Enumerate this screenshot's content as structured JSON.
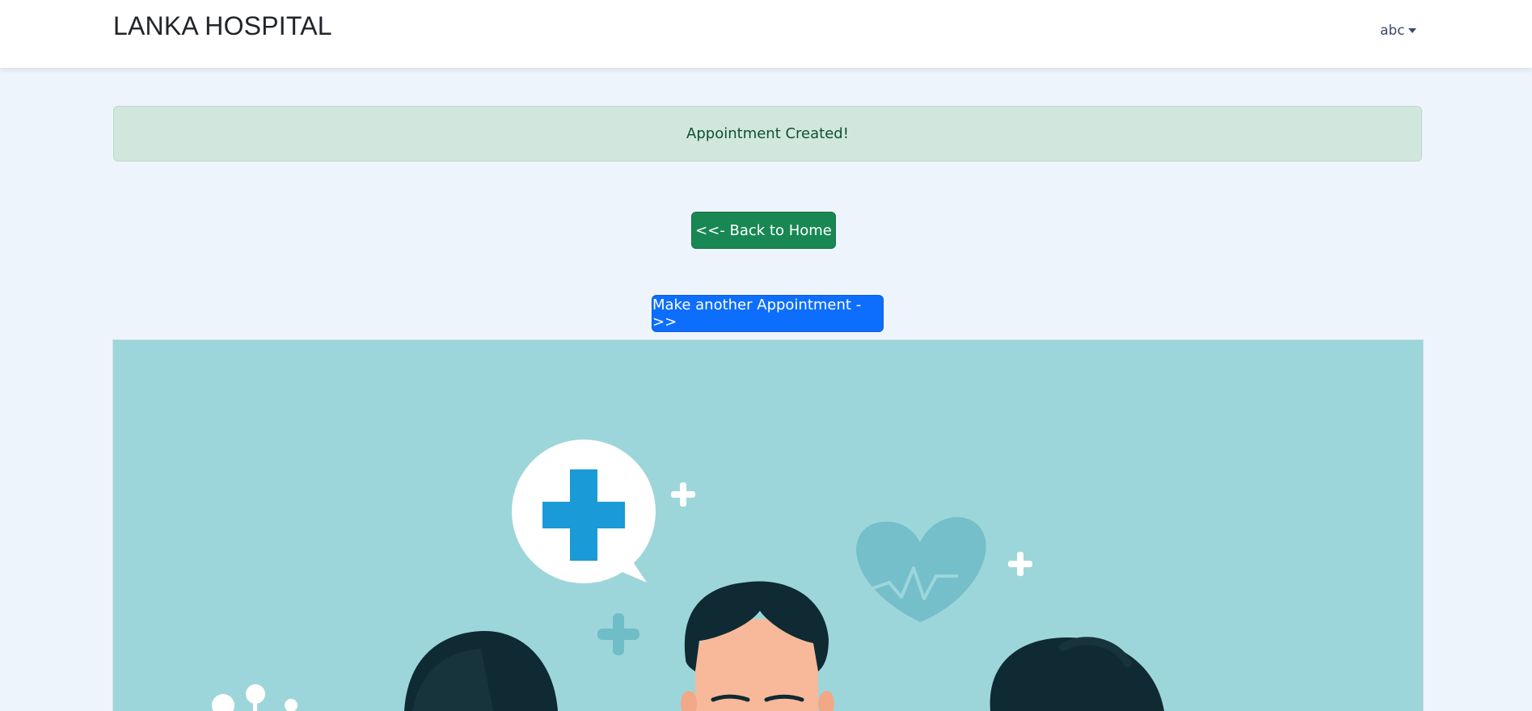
{
  "navbar": {
    "brand": "LANKA HOSPITAL",
    "user_menu_label": "abc"
  },
  "alert": {
    "message": "Appointment Created!"
  },
  "actions": {
    "back_home_label": "<<- Back to Home",
    "make_another_label": "Make another Appointment ->>"
  },
  "colors": {
    "page_bg": "#eef4fc",
    "alert_bg": "#d1e7dd",
    "success": "#198754",
    "primary": "#0d6efd",
    "illustration_bg": "#9dd6da"
  }
}
